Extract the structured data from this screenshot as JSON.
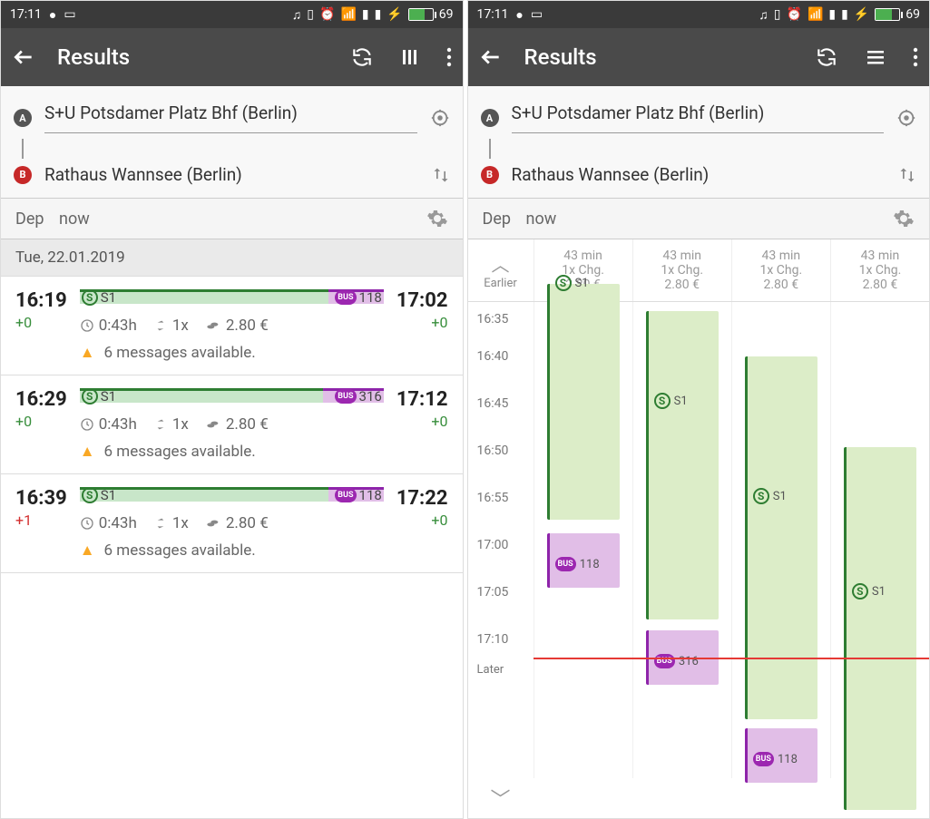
{
  "statusbar": {
    "time": "17:11",
    "battery": "69"
  },
  "appbar": {
    "title": "Results"
  },
  "route": {
    "from": "S+U Potsdamer Platz Bhf (Berlin)",
    "to": "Rathaus Wannsee (Berlin)",
    "depLabel": "Dep",
    "depValue": "now"
  },
  "list": {
    "date": "Tue, 22.01.2019",
    "trips": [
      {
        "dep": "16:19",
        "depDelay": "+0",
        "depColor": "green",
        "arr": "17:02",
        "arrDelay": "+0",
        "arrColor": "green",
        "line1": "S1",
        "line2": "118",
        "bus": "BUS",
        "dur": "0:43h",
        "chg": "1x",
        "price": "2.80 €",
        "msg": "6 messages available."
      },
      {
        "dep": "16:29",
        "depDelay": "+0",
        "depColor": "green",
        "arr": "17:12",
        "arrDelay": "+0",
        "arrColor": "green",
        "line1": "S1",
        "line2": "316",
        "bus": "BUS",
        "dur": "0:43h",
        "chg": "1x",
        "price": "2.80 €",
        "msg": "6 messages available."
      },
      {
        "dep": "16:39",
        "depDelay": "+1",
        "depColor": "red",
        "arr": "17:22",
        "arrDelay": "+0",
        "arrColor": "green",
        "line1": "S1",
        "line2": "118",
        "bus": "BUS",
        "dur": "0:43h",
        "chg": "1x",
        "price": "2.80 €",
        "msg": "6 messages available."
      }
    ]
  },
  "timeline": {
    "earlier": "Earlier",
    "later": "Later",
    "summary": {
      "dur": "43 min",
      "chg": "1x Chg.",
      "price": "2.80 €"
    },
    "times": [
      "16:35",
      "16:40",
      "16:45",
      "16:50",
      "16:55",
      "17:00",
      "17:05",
      "17:10"
    ],
    "lanes": [
      {
        "s1": "S1",
        "bus": "118",
        "busLabel": "BUS"
      },
      {
        "s1": "S1",
        "bus": "316",
        "busLabel": "BUS"
      },
      {
        "s1": "S1",
        "bus": "118",
        "busLabel": "BUS"
      },
      {
        "s1": "S1"
      }
    ]
  }
}
